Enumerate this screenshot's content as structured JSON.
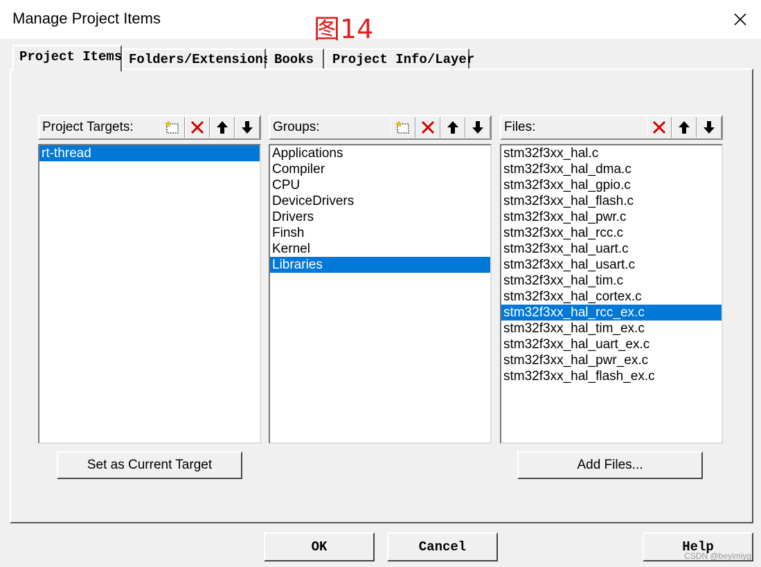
{
  "window": {
    "title": "Manage Project Items"
  },
  "figure_label": "图14",
  "tabs": [
    {
      "label": "Project Items",
      "active": true
    },
    {
      "label": "Folders/Extensions",
      "active": false
    },
    {
      "label": "Books",
      "active": false
    },
    {
      "label": "Project Info/Layer",
      "active": false
    }
  ],
  "targets": {
    "header": "Project Targets:",
    "items": [
      "rt-thread"
    ],
    "selected_index": 0,
    "set_current_label": "Set as Current Target"
  },
  "groups": {
    "header": "Groups:",
    "items": [
      "Applications",
      "Compiler",
      "CPU",
      "DeviceDrivers",
      "Drivers",
      "Finsh",
      "Kernel",
      "Libraries"
    ],
    "selected_index": 7
  },
  "files": {
    "header": "Files:",
    "items": [
      "stm32f3xx_hal.c",
      "stm32f3xx_hal_dma.c",
      "stm32f3xx_hal_gpio.c",
      "stm32f3xx_hal_flash.c",
      "stm32f3xx_hal_pwr.c",
      "stm32f3xx_hal_rcc.c",
      "stm32f3xx_hal_uart.c",
      "stm32f3xx_hal_usart.c",
      "stm32f3xx_hal_tim.c",
      "stm32f3xx_hal_cortex.c",
      "stm32f3xx_hal_rcc_ex.c",
      "stm32f3xx_hal_tim_ex.c",
      "stm32f3xx_hal_uart_ex.c",
      "stm32f3xx_hal_pwr_ex.c",
      "stm32f3xx_hal_flash_ex.c"
    ],
    "selected_index": 10,
    "add_files_label": "Add Files..."
  },
  "footer": {
    "ok_label": "OK",
    "cancel_label": "Cancel",
    "help_label": "Help"
  },
  "watermark": "CSDN @beyimiyg",
  "colors": {
    "selection": "#0078d7",
    "delete_icon": "#d00000",
    "figure_label": "#e02020"
  }
}
